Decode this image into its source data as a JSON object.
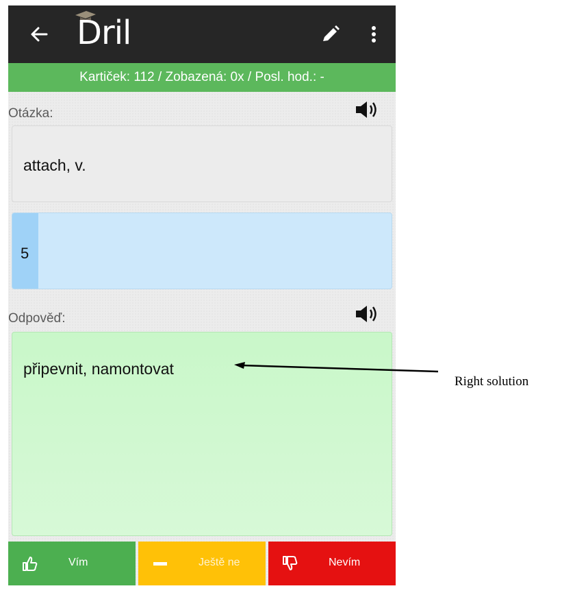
{
  "appbar": {
    "title": "Dril",
    "back_icon": "arrow-left-icon",
    "edit_icon": "pencil-icon",
    "menu_icon": "more-vert-icon"
  },
  "stats": {
    "text": "Kartiček: 112 / Zobazená: 0x / Posl. hod.: -"
  },
  "question": {
    "label": "Otázka:",
    "text": "attach, v."
  },
  "note_card": {
    "text": "5"
  },
  "answer": {
    "label": "Odpověď:",
    "text": "připevnit, namontovat"
  },
  "buttons": {
    "know": "Vím",
    "not_yet": "Ještě ne",
    "dont_know": "Nevím"
  },
  "annotation": {
    "text": "Right solution"
  },
  "colors": {
    "appbar": "#262626",
    "stats": "#5cb85c",
    "know": "#4caf50",
    "not_yet": "#ffc107",
    "dont_know": "#e51111"
  }
}
